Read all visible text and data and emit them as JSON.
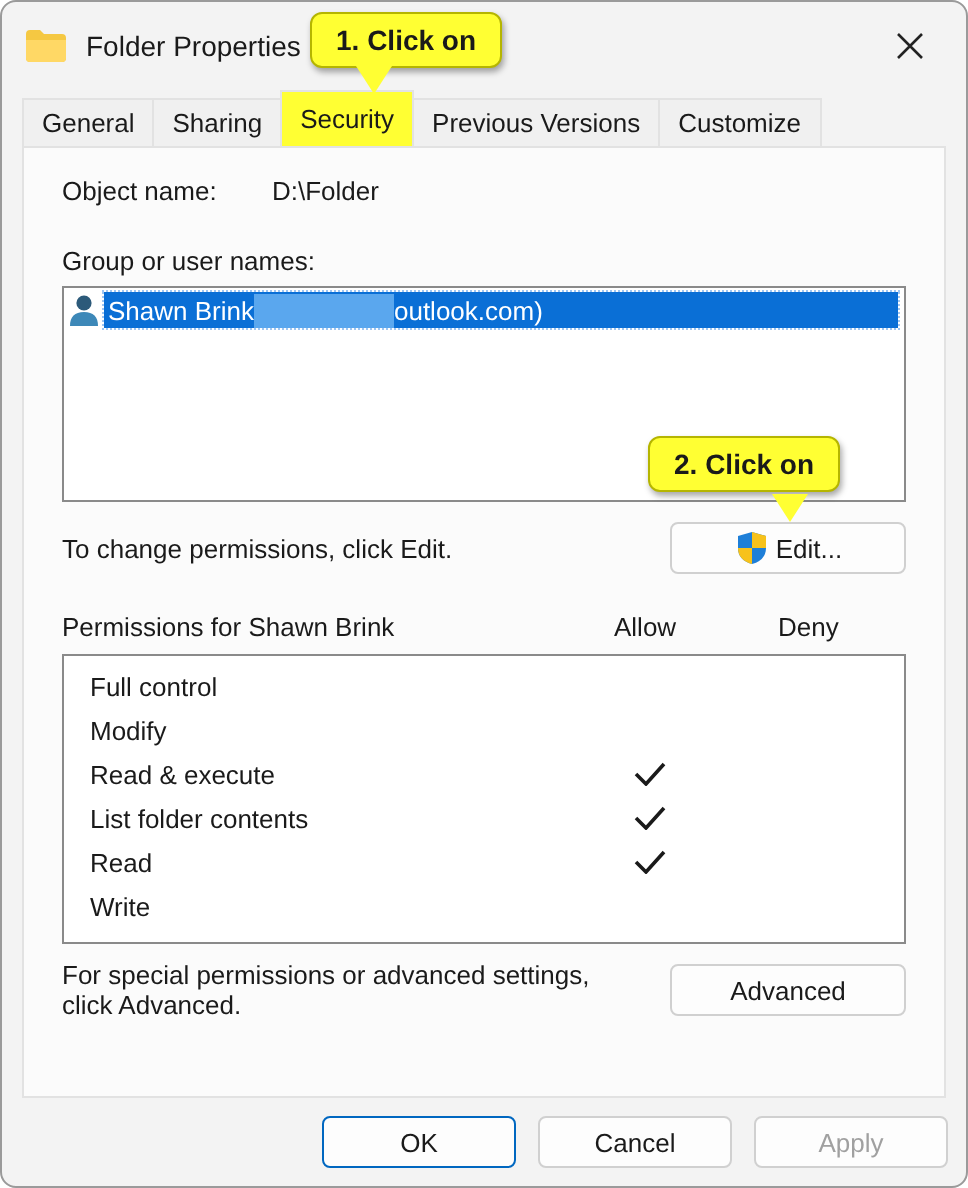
{
  "window": {
    "title": "Folder Properties"
  },
  "tabs": [
    {
      "label": "General",
      "selected": false
    },
    {
      "label": "Sharing",
      "selected": false
    },
    {
      "label": "Security",
      "selected": true
    },
    {
      "label": "Previous Versions",
      "selected": false
    },
    {
      "label": "Customize",
      "selected": false
    }
  ],
  "object_name": {
    "label": "Object name:",
    "value": "D:\\Folder"
  },
  "group_list": {
    "label": "Group or user names:",
    "items": [
      {
        "name": "Shawn Brink",
        "suffix": "outlook.com)",
        "redacted": true,
        "selected": true
      }
    ]
  },
  "edit_hint": "To change permissions, click Edit.",
  "edit_button": "Edit...",
  "permissions": {
    "label": "Permissions for Shawn Brink",
    "allow_header": "Allow",
    "deny_header": "Deny",
    "rows": [
      {
        "name": "Full control",
        "allow": false,
        "deny": false
      },
      {
        "name": "Modify",
        "allow": false,
        "deny": false
      },
      {
        "name": "Read & execute",
        "allow": true,
        "deny": false
      },
      {
        "name": "List folder contents",
        "allow": true,
        "deny": false
      },
      {
        "name": "Read",
        "allow": true,
        "deny": false
      },
      {
        "name": "Write",
        "allow": false,
        "deny": false
      }
    ]
  },
  "advanced_hint": "For special permissions or advanced settings, click Advanced.",
  "advanced_button": "Advanced",
  "buttons": [
    {
      "label": "OK",
      "kind": "default",
      "disabled": false
    },
    {
      "label": "Cancel",
      "kind": "normal",
      "disabled": false
    },
    {
      "label": "Apply",
      "kind": "normal",
      "disabled": true
    }
  ],
  "callouts": [
    {
      "text": "1. Click on"
    },
    {
      "text": "2. Click on"
    }
  ]
}
